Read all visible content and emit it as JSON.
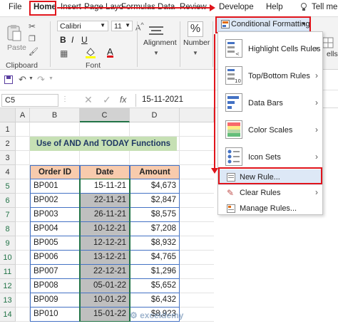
{
  "tabs": [
    "File",
    "Home",
    "Insert",
    "Page Layo",
    "Formulas",
    "Data",
    "Review",
    "Develope",
    "Help",
    "Tell me"
  ],
  "ribbon": {
    "paste_label": "Paste",
    "clipboard_label": "Clipboard",
    "font_name": "Calibri",
    "font_size": "11",
    "bold": "B",
    "italic": "I",
    "underline": "U",
    "font_label": "Font",
    "alignment_label": "Alignment",
    "number_label": "Number",
    "percent_symbol": "%",
    "cells_label": "ells",
    "conditional_formatting": "Conditional Formatting"
  },
  "formula_bar": {
    "name_box": "C5",
    "fx": "fx",
    "value": "15-11-2021"
  },
  "columns": [
    "A",
    "B",
    "C",
    "D"
  ],
  "rows": [
    "1",
    "2",
    "3",
    "4",
    "5",
    "6",
    "7",
    "8",
    "9",
    "10",
    "11",
    "12",
    "13",
    "14"
  ],
  "sheet": {
    "title": "Use of AND And TODAY Functions",
    "headers": [
      "Order ID",
      "Date",
      "Amount"
    ],
    "data": [
      [
        "BP001",
        "15-11-21",
        "$4,673"
      ],
      [
        "BP002",
        "22-11-21",
        "$2,847"
      ],
      [
        "BP003",
        "26-11-21",
        "$8,575"
      ],
      [
        "BP004",
        "10-12-21",
        "$7,208"
      ],
      [
        "BP005",
        "12-12-21",
        "$8,932"
      ],
      [
        "BP006",
        "13-12-21",
        "$4,765"
      ],
      [
        "BP007",
        "22-12-21",
        "$1,296"
      ],
      [
        "BP008",
        "05-01-22",
        "$5,652"
      ],
      [
        "BP009",
        "10-01-22",
        "$6,432"
      ],
      [
        "BP010",
        "15-01-22",
        "$8,923"
      ]
    ]
  },
  "menu": {
    "items": [
      {
        "label": "Highlight Cells Rules",
        "icon": "highlight-cells-icon"
      },
      {
        "label": "Top/Bottom Rules",
        "icon": "top-bottom-icon"
      },
      {
        "label": "Data Bars",
        "icon": "data-bars-icon"
      },
      {
        "label": "Color Scales",
        "icon": "color-scales-icon"
      },
      {
        "label": "Icon Sets",
        "icon": "icon-sets-icon"
      }
    ],
    "new_rule": "New Rule...",
    "clear_rules": "Clear Rules",
    "manage_rules": "Manage Rules..."
  },
  "colors": {
    "accent_red": "#e0141b",
    "title_bg": "#c6e0b4",
    "header_bg": "#f8cbad",
    "selected_fill": "#bfbfbf",
    "table_border": "#4472c4"
  },
  "watermark": "exceldemy"
}
